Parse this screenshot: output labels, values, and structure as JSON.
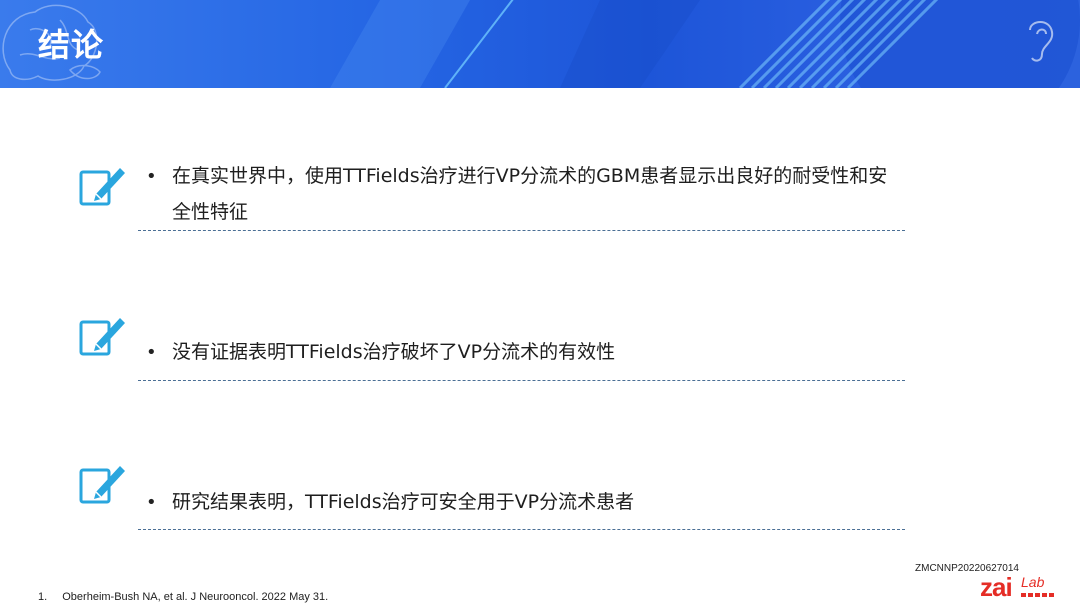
{
  "header": {
    "title": "结论"
  },
  "points": [
    {
      "text": "在真实世界中，使用TTFields治疗进行VP分流术的GBM患者显示出良好的耐受性和安全性特征"
    },
    {
      "text": "没有证据表明TTFields治疗破坏了VP分流术的有效性"
    },
    {
      "text": "研究结果表明，TTFields治疗可安全用于VP分流术患者"
    }
  ],
  "bullet": "•",
  "footer": {
    "code": "ZMCNNP20220627014",
    "logo_main": "zai",
    "logo_sub": "Lab",
    "footnote_number": "1.",
    "footnote_text": "Oberheim-Bush NA, et al. J Neurooncol. 2022 May 31."
  },
  "colors": {
    "header_blue": "#2566e4",
    "icon_blue": "#2aa6de",
    "rule": "#4a6f95",
    "logo_red": "#e52d26"
  },
  "icons": [
    "brain-icon",
    "ear-icon",
    "edit-pen-icon"
  ]
}
